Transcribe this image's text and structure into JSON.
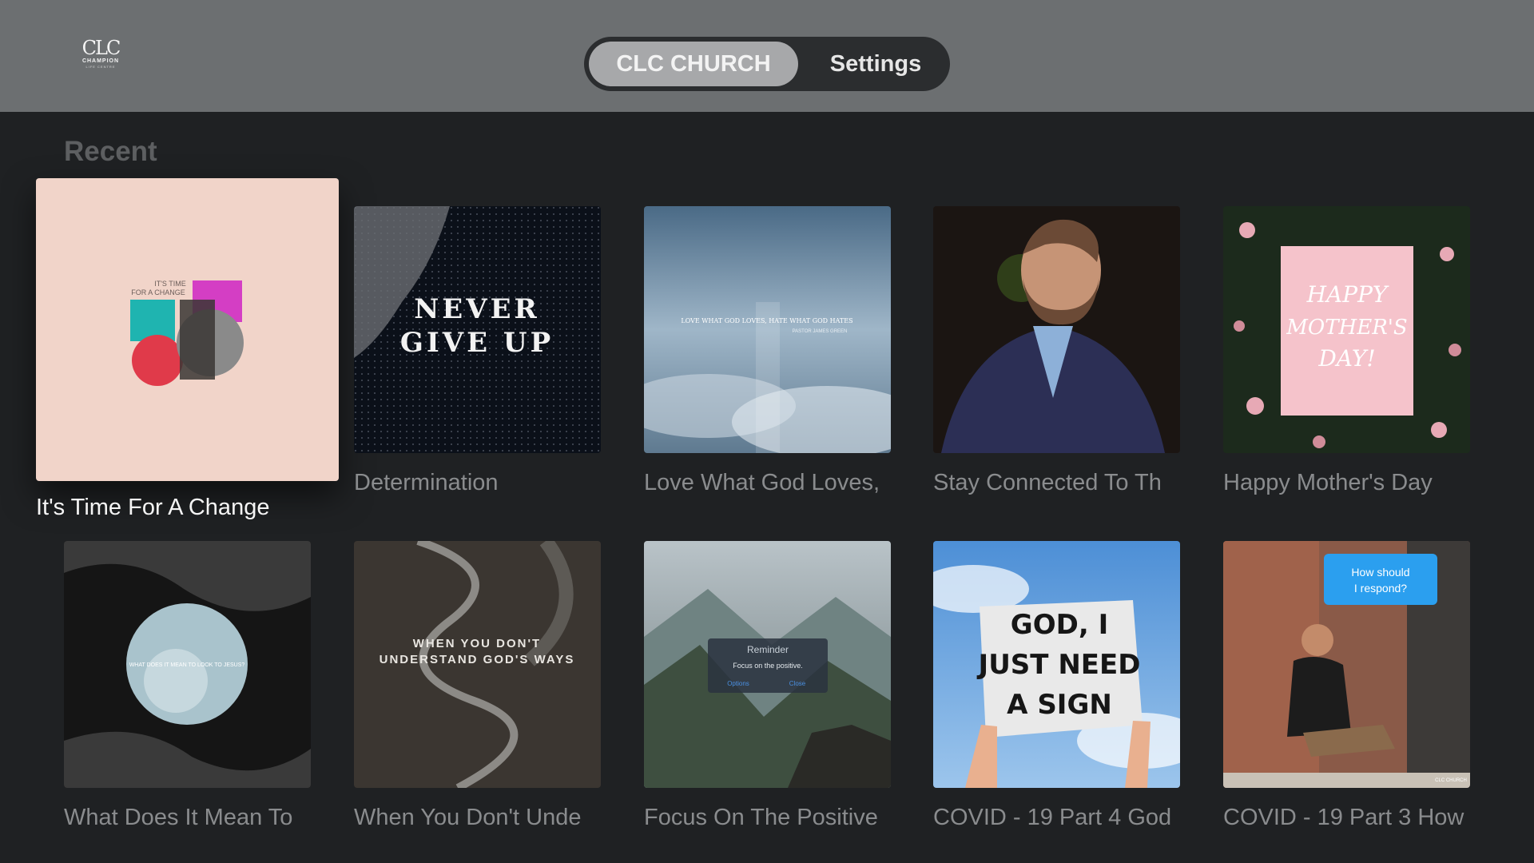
{
  "app": {
    "logo_mark": "CLC",
    "logo_word": "CHAMPION",
    "logo_sub": "LIFE CENTRE"
  },
  "tabs": [
    {
      "label": "CLC CHURCH",
      "selected": true
    },
    {
      "label": "Settings",
      "selected": false
    }
  ],
  "section": {
    "title": "Recent"
  },
  "rows": [
    [
      {
        "title": "It's Time For A Change",
        "focused": true,
        "art_lines": [
          "IT'S TIME",
          "FOR A CHANGE"
        ]
      },
      {
        "title": "Determination",
        "art_lines": [
          "NEVER",
          "GIVE UP"
        ]
      },
      {
        "title": "Love What God Loves,",
        "art_lines": [
          "LOVE WHAT GOD LOVES, HATE WHAT GOD HATES",
          "PASTOR JAMES GREEN"
        ]
      },
      {
        "title": "Stay Connected To Th"
      },
      {
        "title": "Happy Mother's Day",
        "art_lines": [
          "HAPPY",
          "MOTHER'S",
          "DAY!"
        ]
      }
    ],
    [
      {
        "title": "What Does It Mean To",
        "art_lines": [
          "WHAT DOES IT MEAN TO LOOK TO JESUS?"
        ]
      },
      {
        "title": "When You Don't Unde",
        "art_lines": [
          "WHEN YOU DON'T",
          "UNDERSTAND GOD'S WAYS"
        ]
      },
      {
        "title": "Focus On The Positive",
        "art_lines": [
          "Reminder",
          "Focus on the positive.",
          "Options",
          "Close"
        ]
      },
      {
        "title": "COVID - 19 Part 4 God",
        "art_lines": [
          "GOD, I",
          "JUST NEED",
          "A SIGN"
        ]
      },
      {
        "title": "COVID - 19 Part 3 How",
        "art_lines": [
          "How should",
          "I respond?",
          "CLC CHURCH"
        ]
      }
    ]
  ],
  "colors": {
    "topbar": "#6c6f71",
    "background": "#1f2123",
    "tab_active": "#a7a8aa",
    "tabbar": "#2b2d2f"
  }
}
